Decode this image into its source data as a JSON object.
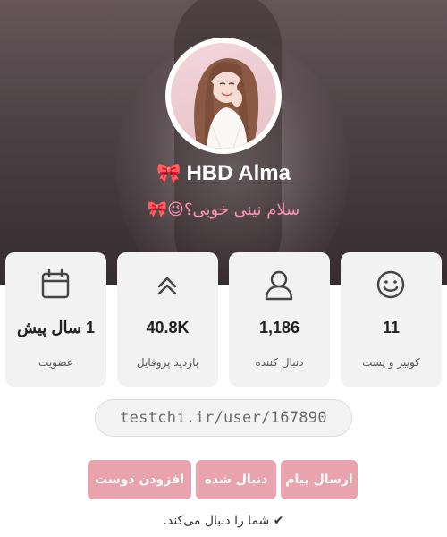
{
  "profile": {
    "name": "HBD Alma",
    "name_emoji": "🎀",
    "bio": "سلام نینی خوبی؟😉🎀"
  },
  "stats": [
    {
      "icon": "calendar-icon",
      "value": "1 سال پیش",
      "label": "عضویت"
    },
    {
      "icon": "chevrons-up-icon",
      "value": "40.8K",
      "label": "بازدید پروفایل"
    },
    {
      "icon": "user-icon",
      "value": "1,186",
      "label": "دنبال کننده"
    },
    {
      "icon": "smiley-icon",
      "value": "11",
      "label": "کوییز و پست"
    }
  ],
  "profile_link": "testchi.ir/user/167890",
  "actions": {
    "add_friend": "افزودن دوست",
    "followed": "دنبال شده",
    "send_message": "ارسال پیام"
  },
  "follow_status": "✔ شما را دنبال می‌کند.",
  "colors": {
    "button_bg": "#e8a3ac",
    "bio_text": "#ff8fb3",
    "card_bg": "#f2f2f2"
  }
}
